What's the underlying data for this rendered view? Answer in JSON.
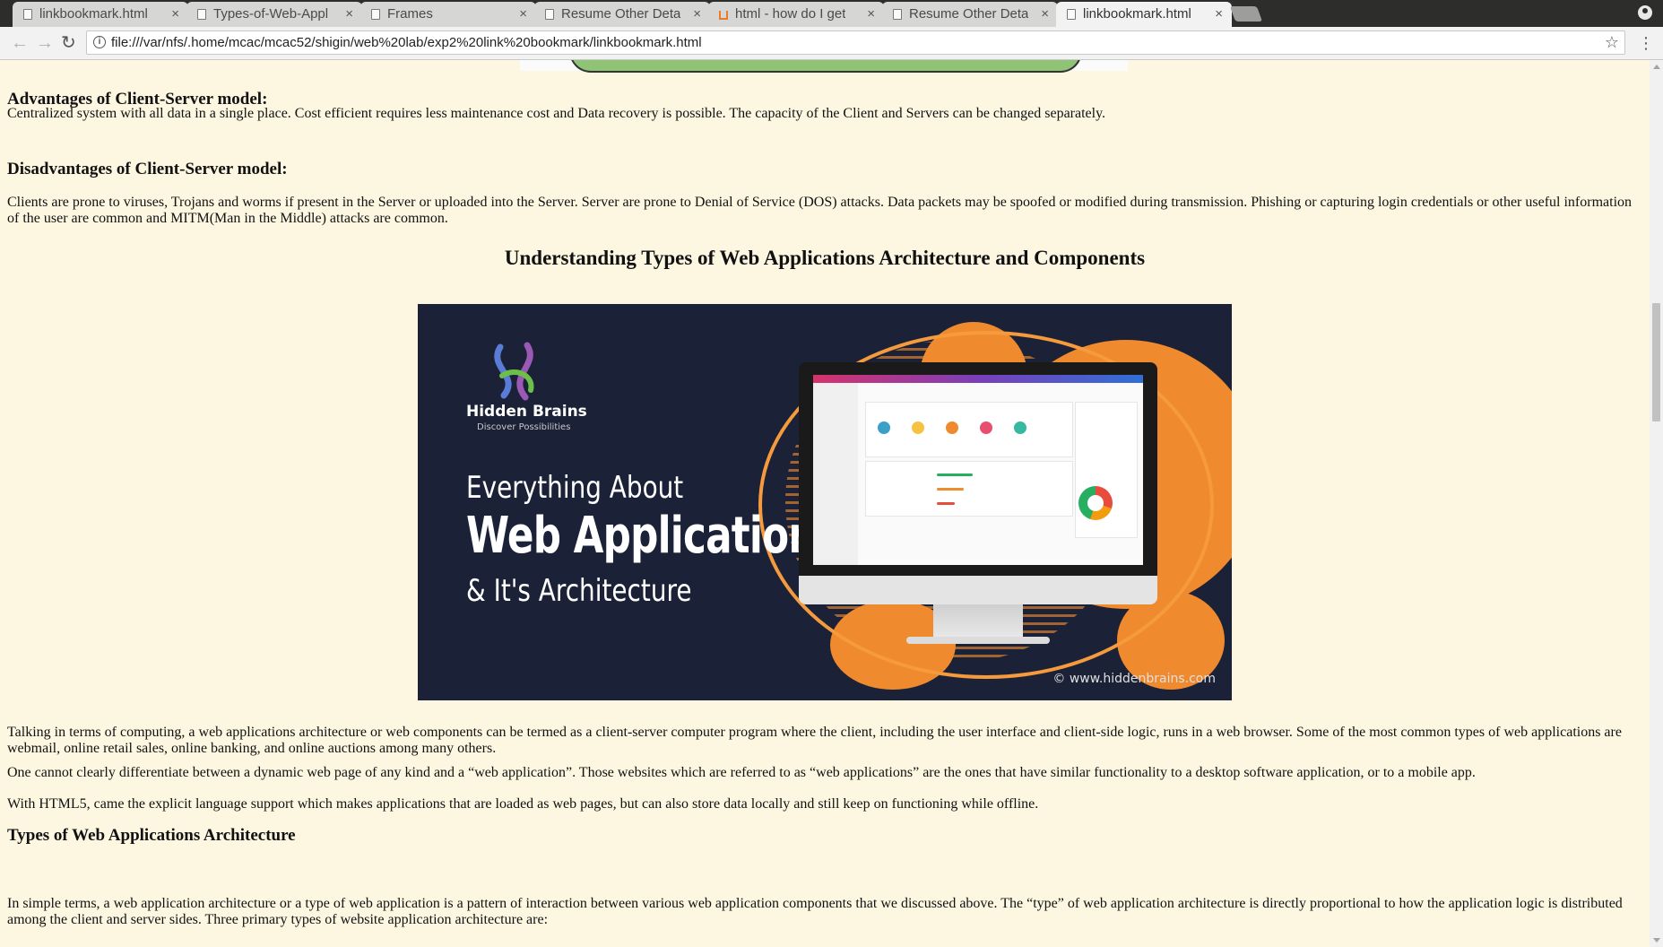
{
  "browser": {
    "tabs": [
      {
        "title": "linkbookmark.html",
        "icon": "page-icon",
        "active": false
      },
      {
        "title": "Types-of-Web-Appl",
        "icon": "page-icon",
        "active": false
      },
      {
        "title": "Frames",
        "icon": "page-icon",
        "active": false
      },
      {
        "title": "Resume Other Deta",
        "icon": "page-icon",
        "active": false
      },
      {
        "title": "html - how do I get",
        "icon": "stackoverflow-icon",
        "active": false
      },
      {
        "title": "Resume Other Deta",
        "icon": "page-icon",
        "active": false
      },
      {
        "title": "linkbookmark.html",
        "icon": "page-icon",
        "active": true
      }
    ],
    "close_glyph": "×",
    "url": "file:///var/nfs/.home/mcac/mcac52/shigin/web%20lab/exp2%20link%20bookmark/linkbookmark.html",
    "nav": {
      "back": "←",
      "forward": "→",
      "reload": "↻",
      "star": "☆",
      "menu": "⋮",
      "info": "i"
    }
  },
  "page": {
    "adv_heading": "Advantages of Client-Server model:",
    "adv_text": "Centralized system with all data in a single place. Cost efficient requires less maintenance cost and Data recovery is possible. The capacity of the Client and Servers can be changed separately.",
    "disadv_heading": "Disadvantages of Client-Server model:",
    "disadv_text": "Clients are prone to viruses, Trojans and worms if present in the Server or uploaded into the Server. Server are prone to Denial of Service (DOS) attacks. Data packets may be spoofed or modified during transmission. Phishing or capturing login credentials or other useful information of the user are common and MITM(Man in the Middle) attacks are common.",
    "section_title": "Understanding Types of Web Applications Architecture and Components",
    "hero": {
      "brand": "Hidden Brains",
      "tagline": "Discover Possibilities",
      "line1": "Everything About",
      "line2": "Web Application",
      "line3": "& It's Architecture",
      "copyright": "© www.hiddenbrains.com"
    },
    "para1": "Talking in terms of computing, a web applications architecture or web components can be termed as a client-server computer program where the client, including the user interface and client-side logic, runs in a web browser. Some of the most common types of web applications are webmail, online retail sales, online banking, and online auctions among many others.",
    "para2": "One cannot clearly differentiate between a dynamic web page of any kind and a “web application”. Those websites which are referred to as “web applications” are the ones that have similar functionality to a desktop software application, or to a mobile app.",
    "para3": "With HTML5, came the explicit language support which makes applications that are loaded as web pages, but can also store data locally and still keep on functioning while offline.",
    "types_heading": "Types of Web Applications Architecture",
    "para4": "In simple terms, a web application architecture or a type of web application is a pattern of interaction between various web application components that we discussed above. The “type” of web application architecture is directly proportional to how the application logic is distributed among the client and server sides. Three primary types of website application architecture are:"
  },
  "colors": {
    "page_background": "#fdf6e0",
    "hero_background": "#1b2237",
    "hero_accent": "#f08a2e"
  }
}
